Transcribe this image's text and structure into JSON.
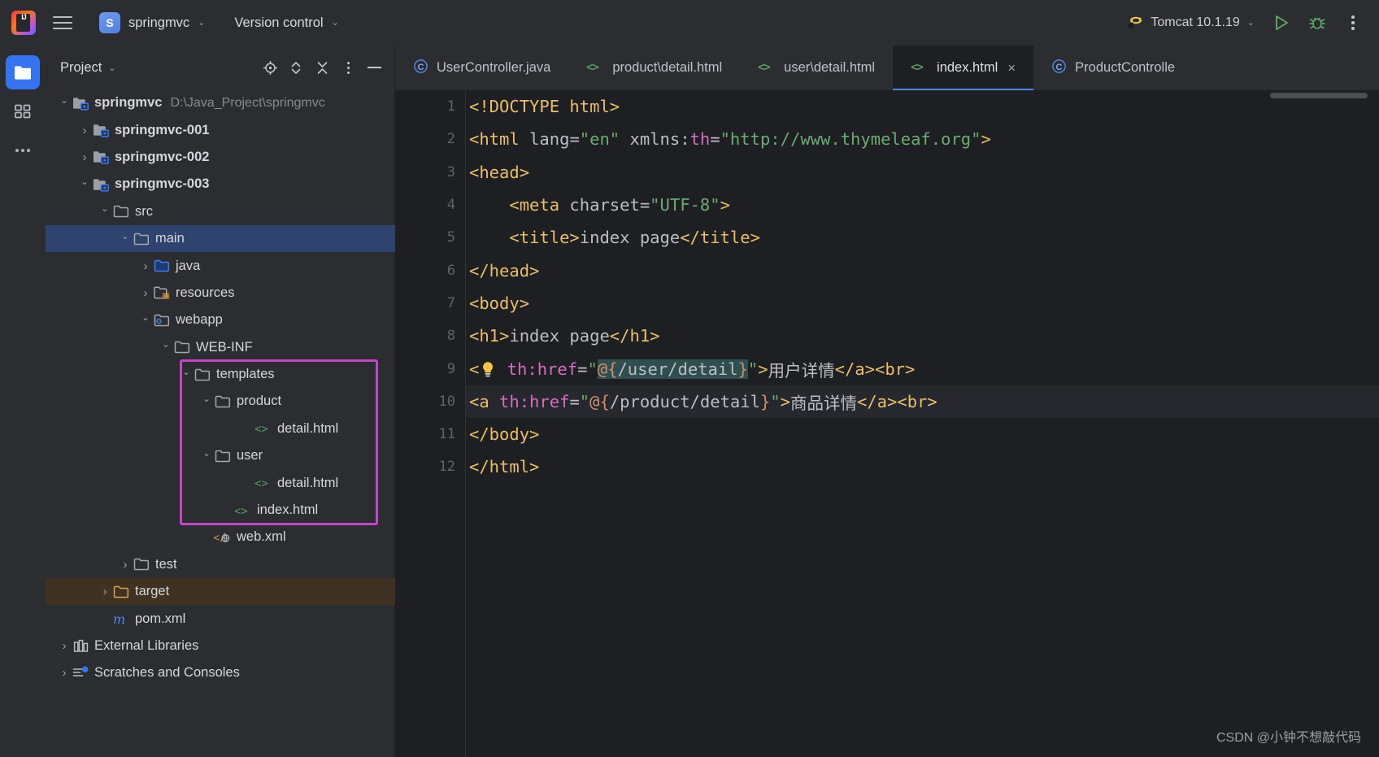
{
  "header": {
    "logo_icon": "intellij-idea-logo",
    "logo_text": "IJ",
    "menu_icon": "hamburger-menu-icon",
    "project_badge": "S",
    "project_name": "springmvc",
    "vcs_label": "Version control",
    "chevron": "⌄",
    "run_config": "Tomcat 10.1.19",
    "run_config_icon": "tomcat-icon",
    "run_icon": "run-button",
    "debug_icon": "debug-button",
    "more_icon": "more-actions-icon",
    "accent_blue": "#3574f0",
    "run_green": "#5fad65"
  },
  "activity_bar": {
    "items": [
      {
        "name": "project-tool-window",
        "icon": "folder-icon",
        "active": true
      },
      {
        "name": "structure-tool-window",
        "icon": "structure-icon",
        "active": false
      },
      {
        "name": "more-tool-windows",
        "icon": "ellipsis-icon",
        "active": false
      }
    ]
  },
  "project_panel": {
    "title": "Project",
    "tools": [
      {
        "name": "select-opened-file",
        "icon": "crosshair-icon"
      },
      {
        "name": "expand-collapse",
        "icon": "updown-chevrons-icon"
      },
      {
        "name": "collapse-all",
        "icon": "collapse-all-icon"
      },
      {
        "name": "panel-options",
        "icon": "kebab-menu-icon"
      },
      {
        "name": "hide-panel",
        "icon": "minus-icon"
      }
    ],
    "tree": [
      {
        "label": "springmvc",
        "path": "D:\\Java_Project\\springmvc",
        "icon": "module-folder-icon",
        "indent": 0,
        "arrow": "open",
        "bold": true,
        "state": "normal"
      },
      {
        "label": "springmvc-001",
        "path": "",
        "icon": "module-folder-icon",
        "indent": 1,
        "arrow": "closed",
        "bold": true,
        "state": "normal"
      },
      {
        "label": "springmvc-002",
        "path": "",
        "icon": "module-folder-icon",
        "indent": 1,
        "arrow": "closed",
        "bold": true,
        "state": "normal"
      },
      {
        "label": "springmvc-003",
        "path": "",
        "icon": "module-folder-icon",
        "indent": 1,
        "arrow": "open",
        "bold": true,
        "state": "normal"
      },
      {
        "label": "src",
        "path": "",
        "icon": "folder-icon",
        "indent": 2,
        "arrow": "open",
        "bold": false,
        "state": "normal"
      },
      {
        "label": "main",
        "path": "",
        "icon": "folder-icon",
        "indent": 3,
        "arrow": "open",
        "bold": false,
        "state": "selected"
      },
      {
        "label": "java",
        "path": "",
        "icon": "source-folder-icon",
        "indent": 4,
        "arrow": "closed",
        "bold": false,
        "state": "normal"
      },
      {
        "label": "resources",
        "path": "",
        "icon": "resources-folder-icon",
        "indent": 4,
        "arrow": "closed",
        "bold": false,
        "state": "normal"
      },
      {
        "label": "webapp",
        "path": "",
        "icon": "webapp-folder-icon",
        "indent": 4,
        "arrow": "open",
        "bold": false,
        "state": "normal"
      },
      {
        "label": "WEB-INF",
        "path": "",
        "icon": "folder-icon",
        "indent": 5,
        "arrow": "open",
        "bold": false,
        "state": "normal"
      },
      {
        "label": "templates",
        "path": "",
        "icon": "folder-icon",
        "indent": 6,
        "arrow": "open",
        "bold": false,
        "state": "normal"
      },
      {
        "label": "product",
        "path": "",
        "icon": "folder-icon",
        "indent": 7,
        "arrow": "open",
        "bold": false,
        "state": "normal"
      },
      {
        "label": "detail.html",
        "path": "",
        "icon": "html-file-icon",
        "indent": 9,
        "arrow": "none",
        "bold": false,
        "state": "normal"
      },
      {
        "label": "user",
        "path": "",
        "icon": "folder-icon",
        "indent": 7,
        "arrow": "open",
        "bold": false,
        "state": "normal"
      },
      {
        "label": "detail.html",
        "path": "",
        "icon": "html-file-icon",
        "indent": 9,
        "arrow": "none",
        "bold": false,
        "state": "normal"
      },
      {
        "label": "index.html",
        "path": "",
        "icon": "html-file-icon",
        "indent": 8,
        "arrow": "none",
        "bold": false,
        "state": "normal"
      },
      {
        "label": "web.xml",
        "path": "",
        "icon": "xml-web-file-icon",
        "indent": 7,
        "arrow": "none",
        "bold": false,
        "state": "normal"
      },
      {
        "label": "test",
        "path": "",
        "icon": "folder-icon",
        "indent": 3,
        "arrow": "closed",
        "bold": false,
        "state": "normal"
      },
      {
        "label": "target",
        "path": "",
        "icon": "excluded-folder-icon",
        "indent": 2,
        "arrow": "closed",
        "bold": false,
        "state": "excluded"
      },
      {
        "label": "pom.xml",
        "path": "",
        "icon": "maven-file-icon",
        "indent": 2,
        "arrow": "none",
        "bold": false,
        "state": "normal"
      },
      {
        "label": "External Libraries",
        "path": "",
        "icon": "libraries-icon",
        "indent": 0,
        "arrow": "closed",
        "bold": false,
        "state": "normal"
      },
      {
        "label": "Scratches and Consoles",
        "path": "",
        "icon": "scratches-icon",
        "indent": 0,
        "arrow": "closed",
        "bold": false,
        "state": "normal"
      }
    ],
    "annotation_color": "#c047c8"
  },
  "editor": {
    "tabs": [
      {
        "label": "UserController.java",
        "icon": "java-class-icon",
        "active": false,
        "closable": false
      },
      {
        "label": "product\\detail.html",
        "icon": "html-file-icon",
        "active": false,
        "closable": false
      },
      {
        "label": "user\\detail.html",
        "icon": "html-file-icon",
        "active": false,
        "closable": false
      },
      {
        "label": "index.html",
        "icon": "html-file-icon",
        "active": true,
        "closable": true
      },
      {
        "label": "ProductControlle",
        "icon": "java-class-icon",
        "active": false,
        "closable": false
      }
    ],
    "close_glyph": "×",
    "line_numbers": [
      "1",
      "2",
      "3",
      "4",
      "5",
      "6",
      "7",
      "8",
      "9",
      "10",
      "11",
      "12"
    ],
    "lines": [
      {
        "n": 1,
        "current": false,
        "segments": [
          {
            "t": "<!DOCTYPE html>",
            "c": "tag"
          }
        ]
      },
      {
        "n": 2,
        "current": false,
        "segments": [
          {
            "t": "<html ",
            "c": "tag"
          },
          {
            "t": "lang",
            "c": "attr"
          },
          {
            "t": "=",
            "c": "txt"
          },
          {
            "t": "\"en\"",
            "c": "val"
          },
          {
            "t": " xmlns:",
            "c": "attr"
          },
          {
            "t": "th",
            "c": "ns"
          },
          {
            "t": "=",
            "c": "txt"
          },
          {
            "t": "\"http://www.thymeleaf.org\"",
            "c": "val"
          },
          {
            "t": ">",
            "c": "tag"
          }
        ]
      },
      {
        "n": 3,
        "current": false,
        "segments": [
          {
            "t": "<head>",
            "c": "tag"
          }
        ]
      },
      {
        "n": 4,
        "current": false,
        "segments": [
          {
            "t": "    <meta ",
            "c": "tag"
          },
          {
            "t": "charset",
            "c": "attr"
          },
          {
            "t": "=",
            "c": "txt"
          },
          {
            "t": "\"UTF-8\"",
            "c": "val"
          },
          {
            "t": ">",
            "c": "tag"
          }
        ]
      },
      {
        "n": 5,
        "current": false,
        "segments": [
          {
            "t": "    <title>",
            "c": "tag"
          },
          {
            "t": "index page",
            "c": "txt"
          },
          {
            "t": "</title>",
            "c": "tag"
          }
        ]
      },
      {
        "n": 6,
        "current": false,
        "segments": [
          {
            "t": "</head>",
            "c": "tag"
          }
        ]
      },
      {
        "n": 7,
        "current": false,
        "segments": [
          {
            "t": "<body>",
            "c": "tag"
          }
        ]
      },
      {
        "n": 8,
        "current": false,
        "segments": [
          {
            "t": "<h1>",
            "c": "tag"
          },
          {
            "t": "index page",
            "c": "txt"
          },
          {
            "t": "</h1>",
            "c": "tag"
          }
        ]
      },
      {
        "n": 9,
        "current": false,
        "bulb": true,
        "segments": [
          {
            "t": "<",
            "c": "tag"
          },
          {
            "t": "BULB",
            "c": "bulb"
          },
          {
            "t": " ",
            "c": "txt"
          },
          {
            "t": "th",
            "c": "ns"
          },
          {
            "t": ":href",
            "c": "ns"
          },
          {
            "t": "=",
            "c": "txt"
          },
          {
            "t": "\"",
            "c": "val"
          },
          {
            "t": "@{",
            "c": "sel-brace"
          },
          {
            "t": "/user/detail",
            "c": "sel-path"
          },
          {
            "t": "}",
            "c": "sel-brace"
          },
          {
            "t": "\"",
            "c": "val"
          },
          {
            "t": ">",
            "c": "tag"
          },
          {
            "t": "用户详情",
            "c": "txt"
          },
          {
            "t": "</a>",
            "c": "tag"
          },
          {
            "t": "<br>",
            "c": "tag"
          }
        ]
      },
      {
        "n": 10,
        "current": true,
        "segments": [
          {
            "t": "<a ",
            "c": "tag"
          },
          {
            "t": "th",
            "c": "ns"
          },
          {
            "t": ":href",
            "c": "ns"
          },
          {
            "t": "=",
            "c": "txt"
          },
          {
            "t": "\"",
            "c": "val"
          },
          {
            "t": "@{",
            "c": "brace"
          },
          {
            "t": "/product/detail",
            "c": "path"
          },
          {
            "t": "}",
            "c": "brace"
          },
          {
            "t": "\"",
            "c": "val"
          },
          {
            "t": ">",
            "c": "tag"
          },
          {
            "t": "商品详情",
            "c": "txt"
          },
          {
            "t": "</a>",
            "c": "tag"
          },
          {
            "t": "<br>",
            "c": "tag"
          }
        ]
      },
      {
        "n": 11,
        "current": false,
        "segments": [
          {
            "t": "</body>",
            "c": "tag"
          }
        ]
      },
      {
        "n": 12,
        "current": false,
        "segments": [
          {
            "t": "</html>",
            "c": "tag"
          }
        ]
      }
    ],
    "colors": {
      "tag": "#e8bf6a",
      "attribute": "#bcbec4",
      "value": "#6aab73",
      "namespace": "#d46ec0",
      "expression_brace": "#cf8e6d",
      "selection_bg": "#2f4f4f",
      "current_line_bg": "#26282e",
      "background": "#1e1f22"
    }
  },
  "watermark": "CSDN @小钟不想敲代码"
}
